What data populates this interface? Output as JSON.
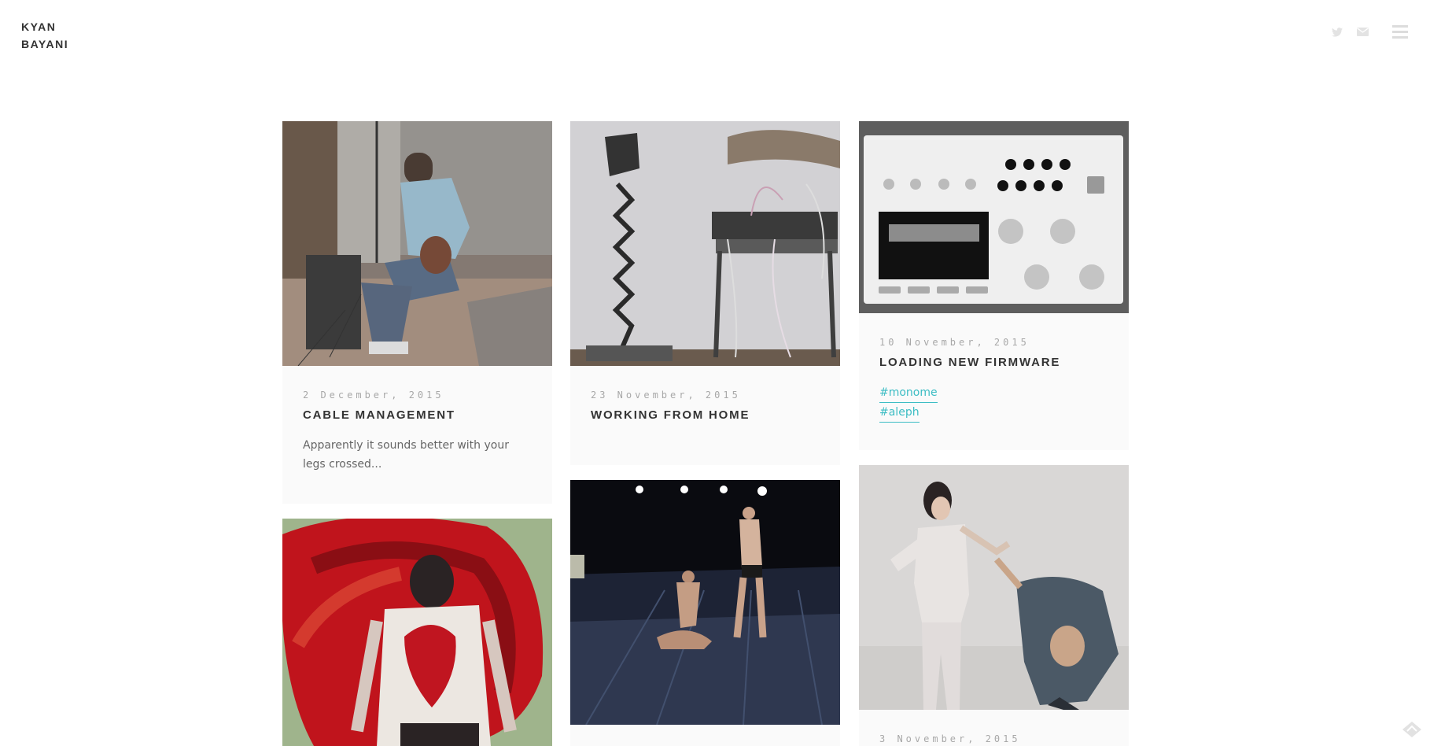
{
  "site": {
    "title_line1": "KYAN",
    "title_line2": "BAYANI"
  },
  "header_icons": [
    "twitter-icon",
    "mail-icon",
    "menu-icon"
  ],
  "colors": {
    "accent": "#3dbdc4",
    "card_bg": "#fafafa",
    "date": "#a8a8a8",
    "heading": "#333333"
  },
  "posts": [
    {
      "date": "2 December, 2015",
      "title": "CABLE MANAGEMENT",
      "excerpt": "Apparently it sounds better with your legs crossed...",
      "image": "musician recording with headphones and guitar"
    },
    {
      "date": "23 November, 2015",
      "title": "WORKING FROM HOME",
      "image": "modular synthesizer on a wooden chair with lamp"
    },
    {
      "date": "10 November, 2015",
      "title": "LOADING NEW FIRMWARE",
      "tags": [
        "#monome",
        "#aleph"
      ],
      "image": "white monome aleph sound computer"
    },
    {
      "image": "dancer in front of red painted wall"
    },
    {
      "image": "two dancers on dark stage"
    },
    {
      "date": "3 November, 2015",
      "image": "two dancers in grey clothes"
    }
  ]
}
